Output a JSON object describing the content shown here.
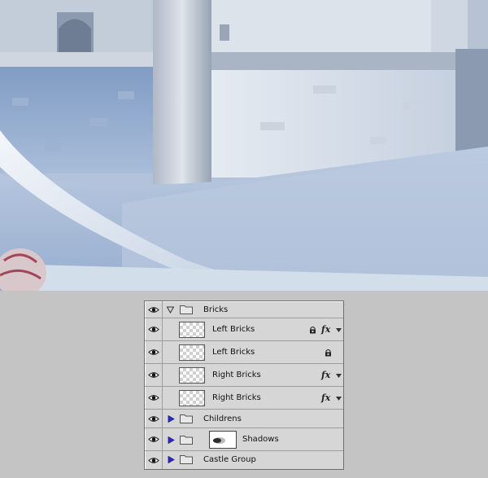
{
  "scene": {
    "description_icon": "castle-artwork"
  },
  "layers_panel": {
    "layers": [
      {
        "id": "bricks",
        "label": "Bricks",
        "type": "group",
        "expanded": true
      },
      {
        "id": "left-bricks-1",
        "label": "Left Bricks",
        "type": "layer",
        "locked": true,
        "effects": true
      },
      {
        "id": "left-bricks-2",
        "label": "Left Bricks",
        "type": "layer",
        "locked": true,
        "effects": false
      },
      {
        "id": "right-bricks-1",
        "label": "Right Bricks",
        "type": "layer",
        "locked": false,
        "effects": true
      },
      {
        "id": "right-bricks-2",
        "label": "Right Bricks",
        "type": "layer",
        "locked": false,
        "effects": true
      },
      {
        "id": "childrens",
        "label": "Childrens",
        "type": "group",
        "expanded": false
      },
      {
        "id": "shadows",
        "label": "Shadows",
        "type": "group",
        "expanded": false,
        "has_mask": true
      },
      {
        "id": "castle-group",
        "label": "Castle Group",
        "type": "group",
        "expanded": false
      }
    ],
    "fx_text": "fx",
    "icons": {
      "visibility": "eye-icon",
      "expand": "triangle-icon",
      "folder": "folder-icon",
      "lock": "lock-icon",
      "effects": "fx-icon",
      "effects_toggle": "chevron-down-icon"
    }
  }
}
